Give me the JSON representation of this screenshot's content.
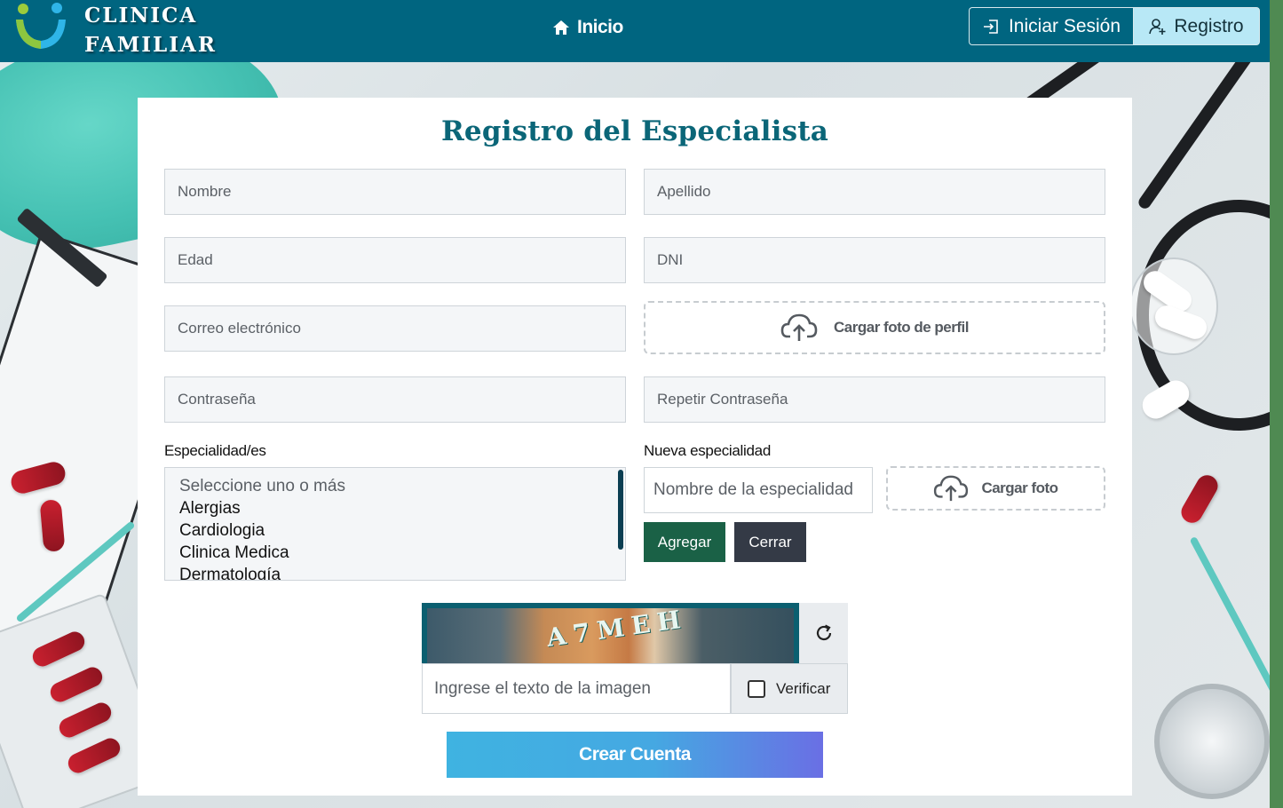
{
  "header": {
    "brand_line1": "CLINICA",
    "brand_line2": "FAMILIAR",
    "nav_home": "Inicio",
    "login_label": "Iniciar Sesión",
    "register_label": "Registro"
  },
  "form": {
    "title": "Registro del Especialista",
    "fields": {
      "nombre": "Nombre",
      "apellido": "Apellido",
      "edad": "Edad",
      "dni": "DNI",
      "correo": "Correo electrónico",
      "contrasena": "Contraseña",
      "repetir_contrasena": "Repetir Contraseña"
    },
    "upload_profile": "Cargar foto de perfil",
    "specialties_label": "Especialidad/es",
    "specialties_options": [
      "Seleccione uno o más",
      "Alergias",
      "Cardiologia",
      "Clinica Medica",
      "Dermatología"
    ],
    "new_specialty_label": "Nueva especialidad",
    "new_specialty_placeholder": "Nombre de la especialidad",
    "upload_photo": "Cargar foto",
    "add_button": "Agregar",
    "close_button": "Cerrar",
    "captcha_text": "A7MEH",
    "captcha_placeholder": "Ingrese el texto de la imagen",
    "verify_label": "Verificar",
    "verify_checked": false,
    "submit_button": "Crear Cuenta"
  },
  "icons": {
    "home": "home-icon",
    "login": "login-icon",
    "register": "user-plus-icon",
    "upload": "cloud-upload-icon",
    "refresh": "refresh-icon"
  },
  "colors": {
    "header_bg": "#006580",
    "title": "#0b6678",
    "add_button": "#1a6146",
    "close_button": "#343a46",
    "register_button": "#b8e8f6"
  }
}
